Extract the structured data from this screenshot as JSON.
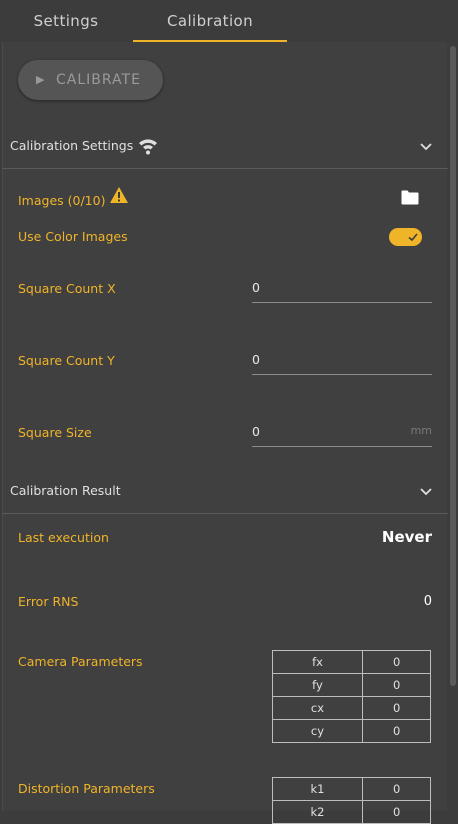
{
  "tabs": [
    {
      "label": "Settings"
    },
    {
      "label": "Calibration"
    }
  ],
  "calibrate_button": {
    "label": "CALIBRATE"
  },
  "calibration_settings": {
    "title": "Calibration Settings",
    "images_label": "Images (0/10)",
    "use_color_label": "Use Color Images",
    "use_color_value": true,
    "square_count_x": {
      "label": "Square Count X",
      "value": "0"
    },
    "square_count_y": {
      "label": "Square Count Y",
      "value": "0"
    },
    "square_size": {
      "label": "Square Size",
      "value": "0",
      "unit": "mm"
    }
  },
  "calibration_result": {
    "title": "Calibration Result",
    "last_execution_label": "Last execution",
    "last_execution_value": "Never",
    "error_label": "Error RNS",
    "error_value": "0",
    "camera_params_label": "Camera Parameters",
    "camera_params": [
      {
        "name": "fx",
        "value": "0"
      },
      {
        "name": "fy",
        "value": "0"
      },
      {
        "name": "cx",
        "value": "0"
      },
      {
        "name": "cy",
        "value": "0"
      }
    ],
    "distortion_params_label": "Distortion Parameters",
    "distortion_params": [
      {
        "name": "k1",
        "value": "0"
      },
      {
        "name": "k2",
        "value": "0"
      }
    ]
  },
  "colors": {
    "accent": "#f0b429",
    "background": "#3c3c3c",
    "panel": "#404040",
    "label": "#f0b429",
    "text": "#e0e0e0"
  },
  "icons": [
    "play-icon",
    "wifi-icon",
    "chevron-down-icon",
    "warning-icon",
    "folder-icon",
    "check-icon"
  ]
}
